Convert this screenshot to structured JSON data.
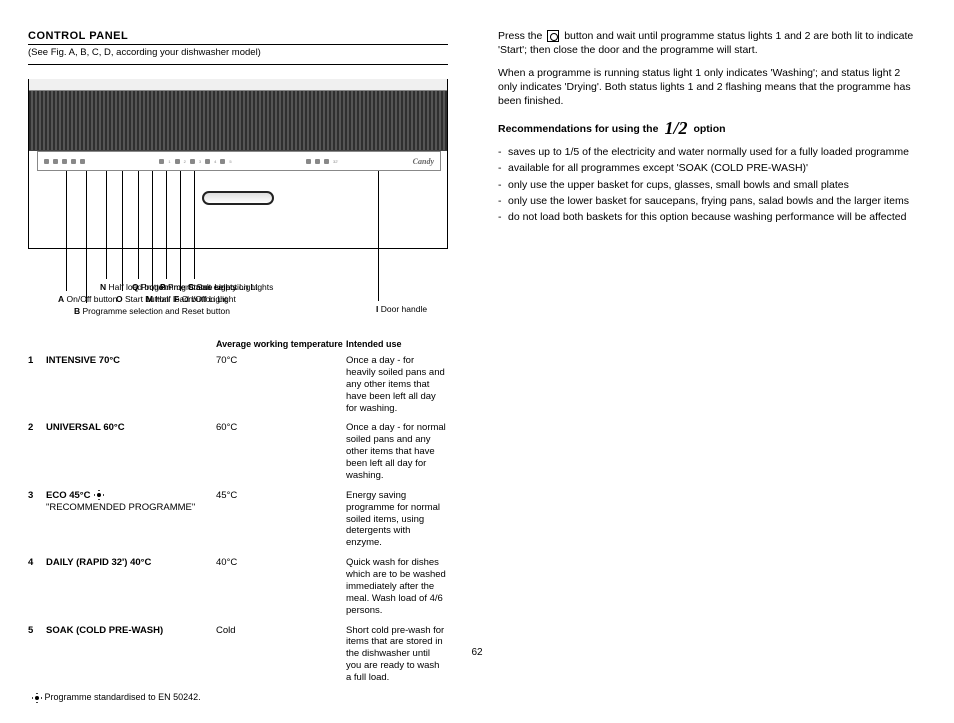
{
  "title": "CONTROL PANEL",
  "subtitle": "(See Fig. A, B, C, D, according your dishwasher model)",
  "brand": "Candy",
  "pointers": {
    "I": "Door handle",
    "A": "On/Off button",
    "B": "Programme selection and Reset button",
    "N": "Half load button",
    "O": "Start button",
    "Q": "Programme Status Lights",
    "M": "Half load button Light",
    "P": "Programme selection Lights",
    "F": "On/Off Light",
    "C": "Salt empty Light"
  },
  "right": {
    "p1_a": "Press the ",
    "p1_b": " button and wait until programme status lights 1 and 2 are both lit to indicate 'Start'; then close the door and the programme will start.",
    "p2": "When a programme is running status light 1 only indicates 'Washing'; and status light 2 only indicates 'Drying'. Both status lights 1 and 2 flashing means that the programme has been finished.",
    "reco_title_a": "Recommendations for using the",
    "reco_title_b": "option",
    "bullets": [
      "saves up to 1/5 of the electricity and water normally used for a fully loaded programme",
      "available for all programmes except 'SOAK (COLD PRE-WASH)'",
      "only use the upper basket for cups, glasses, small bowls and small plates",
      "only use the lower basket for saucepans, frying pans, salad bowls and the larger items",
      "do not load both baskets for this option because washing performance will be affected"
    ]
  },
  "table_headers": {
    "temp": "Average working temperature",
    "use": "Intended use"
  },
  "programs": [
    {
      "id": "1",
      "name": "INTENSIVE 70°C",
      "temp": "70°C",
      "use": "Once a day - for heavily soiled pans and any other items that have been left all day for washing."
    },
    {
      "id": "2",
      "name": "UNIVERSAL 60°C",
      "temp": "60°C",
      "use": "Once a day - for normal soiled pans and any other items that have been left all day for washing."
    },
    {
      "id": "3",
      "name_a": "ECO 45°C",
      "name_b": "\"RECOMMENDED PROGRAMME\"",
      "sun": true,
      "temp": "45°C",
      "use": "Energy saving programme for normal soiled items, using detergents with enzyme."
    },
    {
      "id": "4",
      "name": "DAILY (RAPID 32') 40°C",
      "temp": "40°C",
      "use": "Quick wash for dishes which are to be washed immediately after the meal. Wash load of 4/6 persons."
    },
    {
      "id": "5",
      "name": "SOAK (COLD PRE-WASH)",
      "temp": "Cold",
      "use": "Short cold pre-wash for items that are stored in the dishwasher until you are ready to wash a full load."
    }
  ],
  "footnote": "Programme standardised to EN 50242.",
  "page": "62"
}
